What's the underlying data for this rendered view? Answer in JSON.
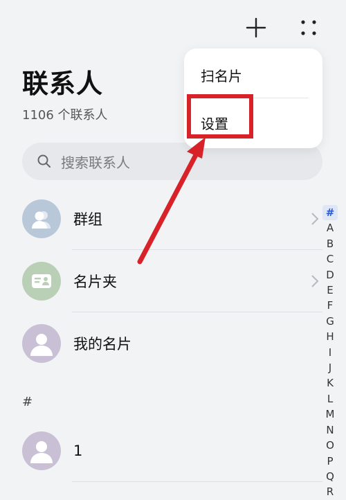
{
  "header": {
    "title": "联系人",
    "count": "1106 个联系人"
  },
  "toolbar": {
    "add_icon": "plus-icon",
    "more_icon": "more-dots-icon"
  },
  "search": {
    "placeholder": "搜索联系人",
    "icon": "search-icon"
  },
  "menu": {
    "items": [
      {
        "label": "扫名片"
      },
      {
        "label": "设置"
      }
    ]
  },
  "list": {
    "top_items": [
      {
        "label": "群组",
        "icon": "group-icon",
        "avatar_color": "#b9c8d8",
        "has_chevron": true
      },
      {
        "label": "名片夹",
        "icon": "business-card-icon",
        "avatar_color": "#b9d0b6",
        "has_chevron": true
      },
      {
        "label": "我的名片",
        "icon": "person-icon",
        "avatar_color": "#c9c0d6",
        "has_chevron": false
      }
    ],
    "section_header": "#",
    "contacts": [
      {
        "name": "1",
        "icon": "person-icon",
        "avatar_color": "#c9c0d6"
      }
    ]
  },
  "alpha_index": [
    "#",
    "A",
    "B",
    "C",
    "D",
    "E",
    "F",
    "G",
    "H",
    "I",
    "J",
    "K",
    "L",
    "M",
    "N",
    "O",
    "P",
    "Q",
    "R"
  ],
  "alpha_active": "#",
  "annotation": {
    "color": "#d8222a"
  }
}
